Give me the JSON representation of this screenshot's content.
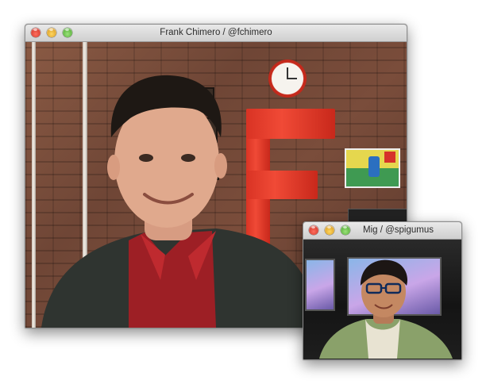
{
  "main_window": {
    "title": "Frank Chimero / @fchimero"
  },
  "small_window": {
    "title": "Mig / @spigumus"
  },
  "colors": {
    "close": "#e0443a",
    "minimize": "#f2b23b",
    "zoom": "#63c54a",
    "titlebar": "#dcdcdc"
  }
}
